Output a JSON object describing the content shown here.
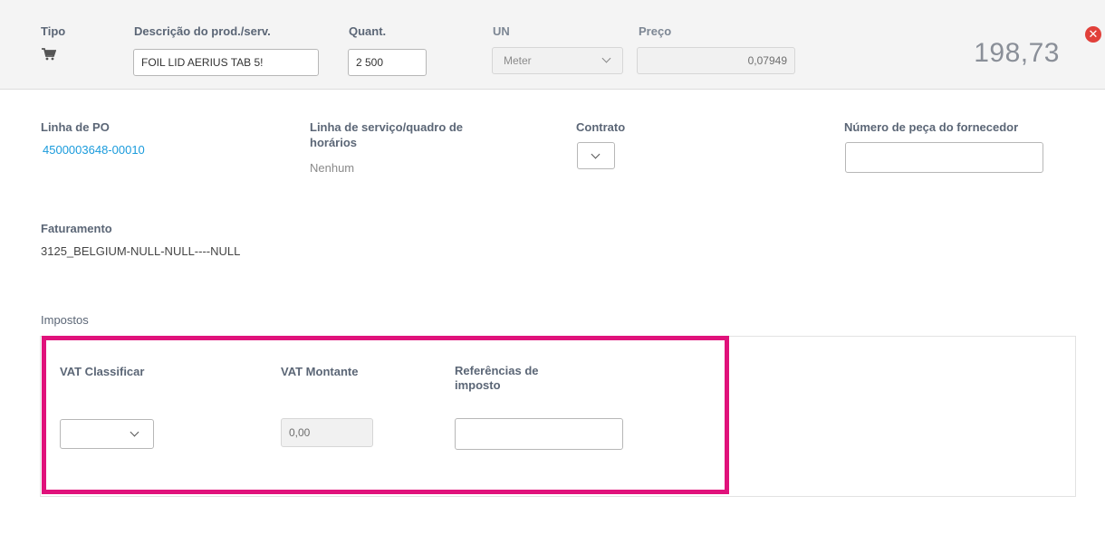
{
  "header": {
    "labels": {
      "tipo": "Tipo",
      "descricao": "Descrição do prod./serv.",
      "quant": "Quant.",
      "un": "UN",
      "preco": "Preço"
    },
    "tipo_icon": "shopping-cart-icon",
    "descricao_value": "FOIL LID AERIUS TAB 5!",
    "quant_value": "2 500",
    "un_value": "Meter",
    "preco_value": "0,07949",
    "total": "198,73",
    "close_icon": "close-icon"
  },
  "details": {
    "po_line_label": "Linha de PO",
    "po_line_value": "4500003648-00010",
    "service_line_label_1": "Linha de serviço/quadro de",
    "service_line_label_2": "horários",
    "service_line_value": "Nenhum",
    "contract_label": "Contrato",
    "supplier_part_label": "Número de peça do fornecedor",
    "billing_label": "Faturamento",
    "billing_value": "3125_BELGIUM-NULL-NULL----NULL"
  },
  "taxes": {
    "section_label": "Impostos",
    "vat_class_label": "VAT Classificar",
    "vat_amount_label": "VAT Montante",
    "vat_amount_value": "0,00",
    "tax_refs_label_1": "Referências de",
    "tax_refs_label_2": "imposto"
  },
  "colors": {
    "highlight": "#e0127b",
    "link": "#1a9bdc",
    "close": "#e1403a"
  }
}
